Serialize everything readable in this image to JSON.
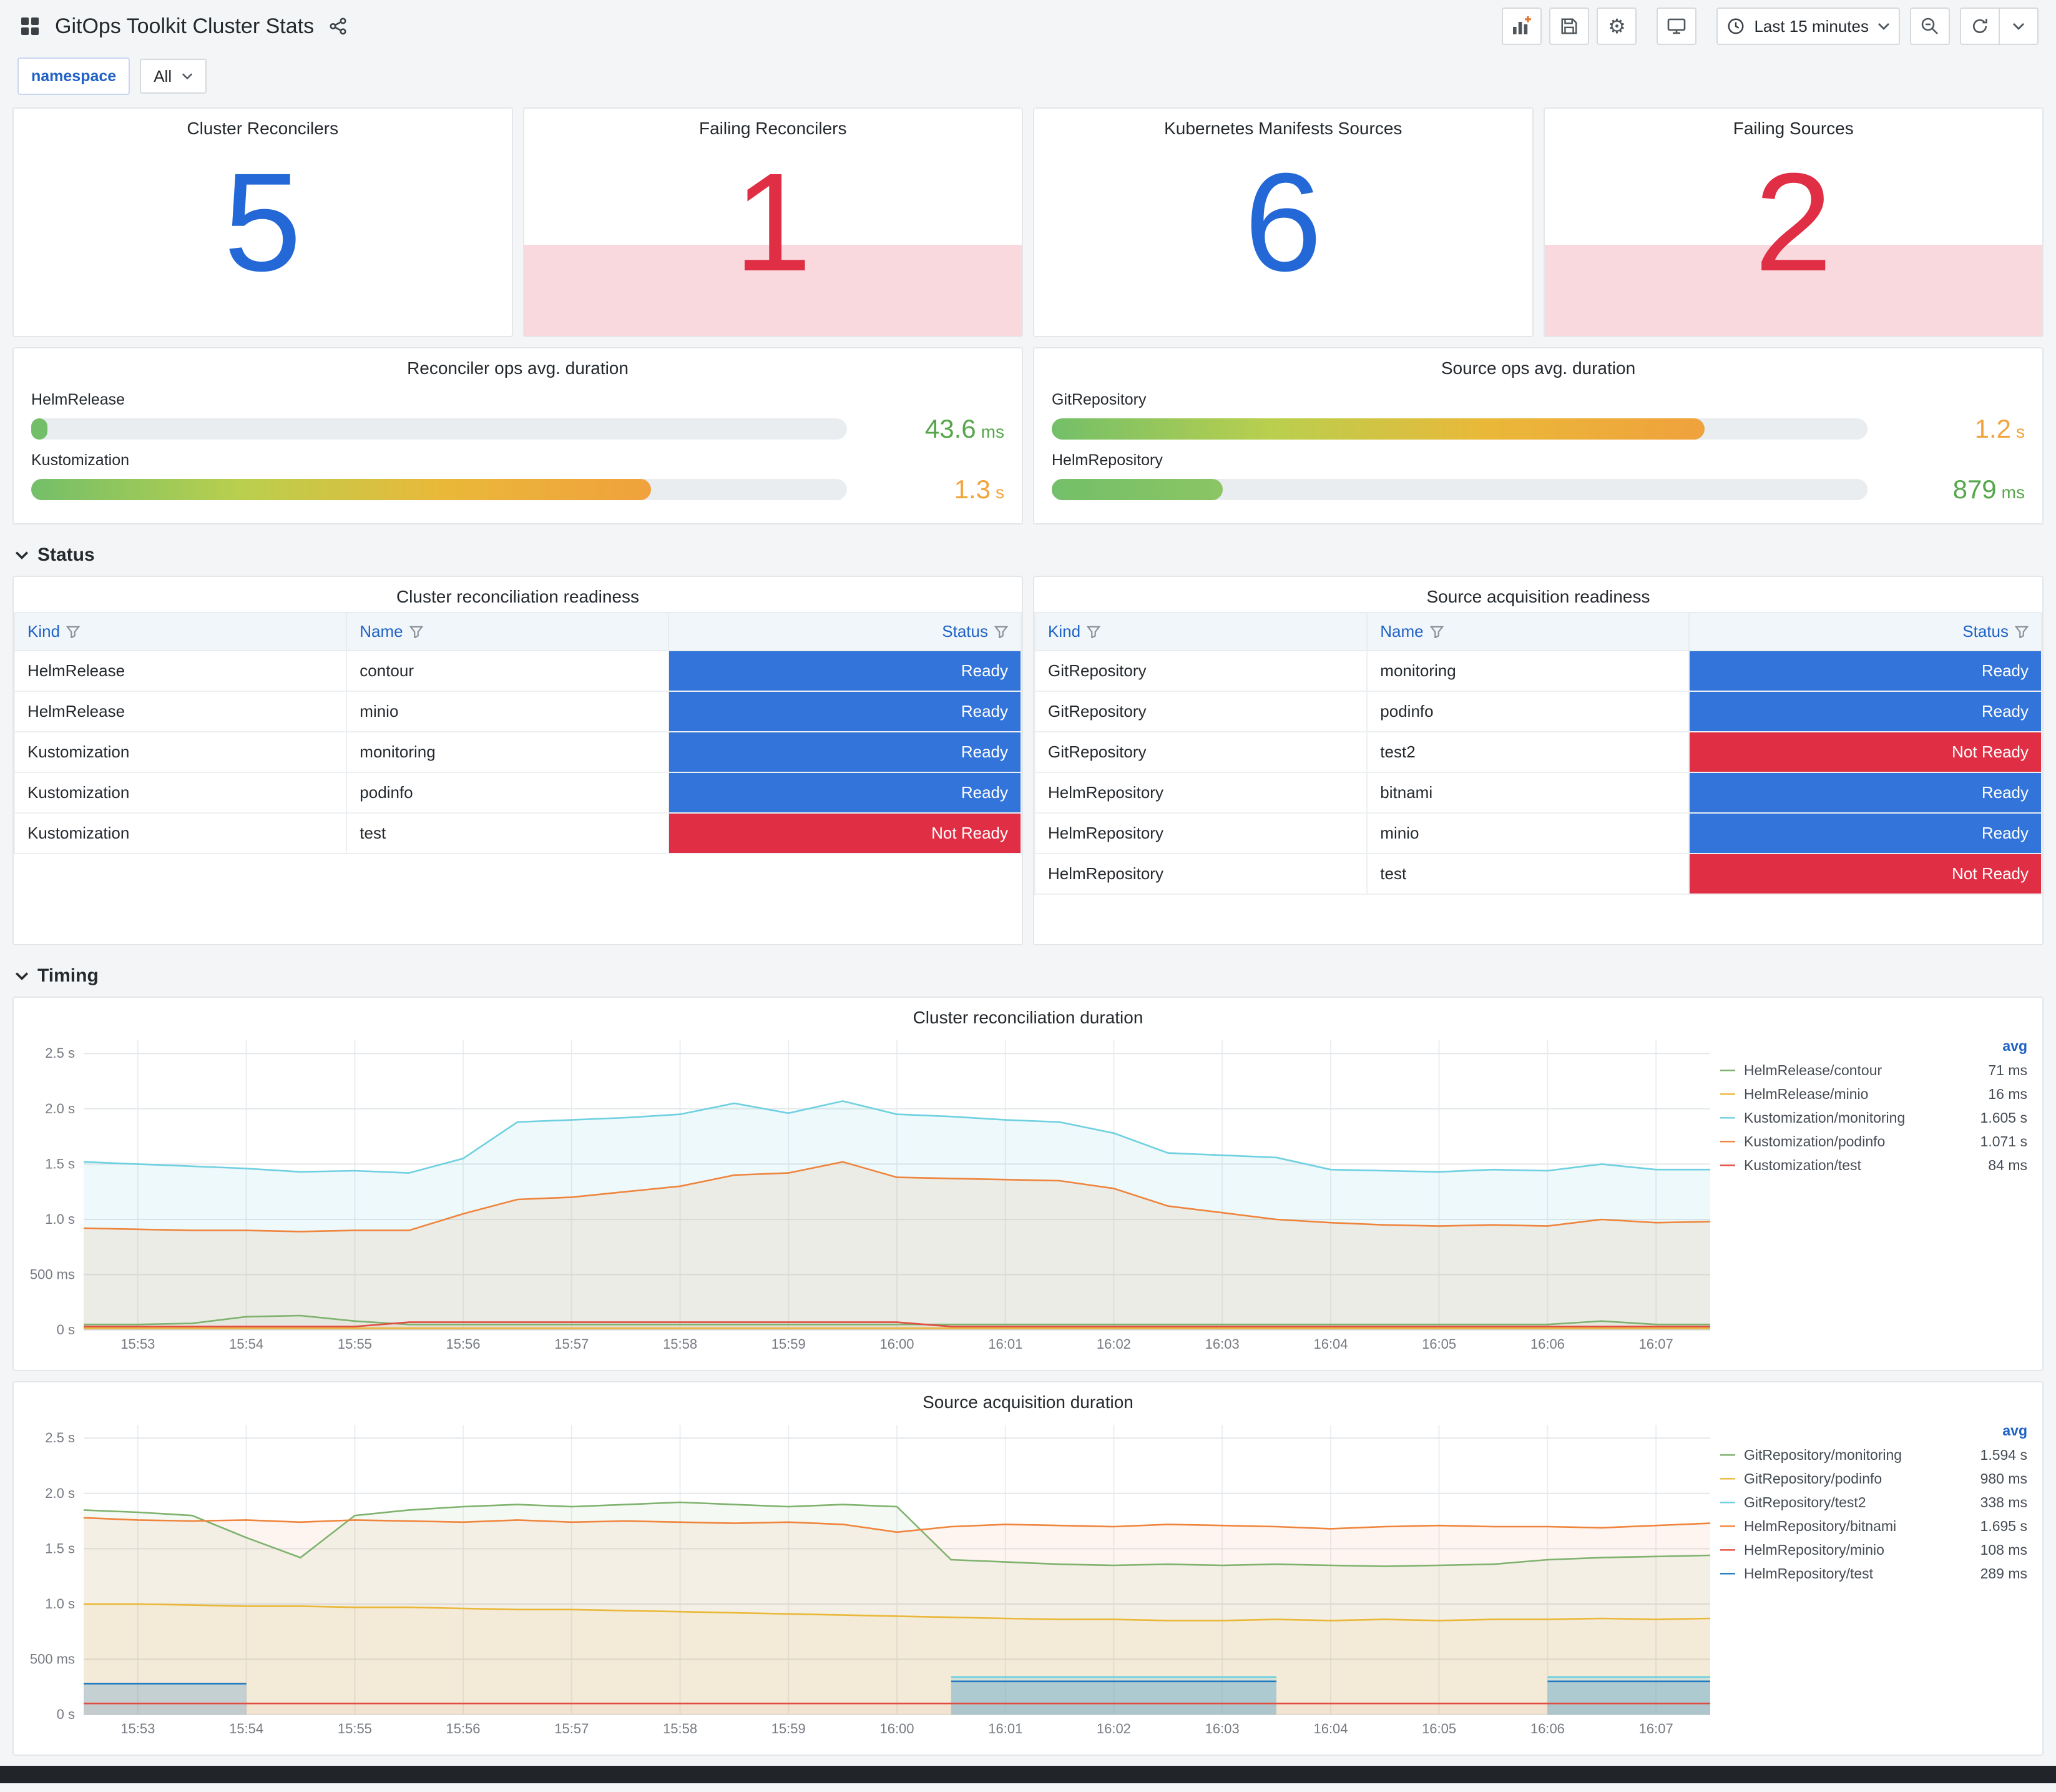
{
  "header": {
    "title": "GitOps Toolkit Cluster Stats",
    "time_range": "Last 15 minutes"
  },
  "variables": {
    "name": "namespace",
    "value": "All"
  },
  "colors": {
    "ready": "#3274d9",
    "not_ready": "#e02f44",
    "stat_blue": "#2368d6",
    "stat_red": "#e02f44",
    "link_blue": "#1f62c6"
  },
  "stat_panels": [
    {
      "title": "Cluster Reconcilers",
      "value": "5",
      "color": "#2368d6",
      "alert_band": false
    },
    {
      "title": "Failing Reconcilers",
      "value": "1",
      "color": "#e02f44",
      "alert_band": true
    },
    {
      "title": "Kubernetes Manifests Sources",
      "value": "6",
      "color": "#2368d6",
      "alert_band": false
    },
    {
      "title": "Failing Sources",
      "value": "2",
      "color": "#e02f44",
      "alert_band": true
    }
  ],
  "gauge_panels": [
    {
      "title": "Reconciler ops avg. duration",
      "rows": [
        {
          "label": "HelmRelease",
          "value": "43.6",
          "unit": "ms",
          "pct": 2,
          "value_color": "#56a64b",
          "bar_colors": [
            "#73bf69"
          ]
        },
        {
          "label": "Kustomization",
          "value": "1.3",
          "unit": "s",
          "pct": 76,
          "value_color": "#f2a33c",
          "bar_colors": [
            "#73bf69",
            "#b9cf4e",
            "#eab839",
            "#f0a13c"
          ]
        }
      ]
    },
    {
      "title": "Source ops avg. duration",
      "rows": [
        {
          "label": "GitRepository",
          "value": "1.2",
          "unit": "s",
          "pct": 80,
          "value_color": "#f2a33c",
          "bar_colors": [
            "#73bf69",
            "#b9cf4e",
            "#eab839",
            "#f0a13c"
          ]
        },
        {
          "label": "HelmRepository",
          "value": "879",
          "unit": "ms",
          "pct": 21,
          "value_color": "#56a64b",
          "bar_colors": [
            "#73bf69",
            "#8cc564"
          ]
        }
      ]
    }
  ],
  "sections": {
    "status": "Status",
    "timing": "Timing"
  },
  "tables": [
    {
      "title": "Cluster reconciliation readiness",
      "columns": [
        "Kind",
        "Name",
        "Status"
      ],
      "rows": [
        {
          "kind": "HelmRelease",
          "name": "contour",
          "status": "Ready"
        },
        {
          "kind": "HelmRelease",
          "name": "minio",
          "status": "Ready"
        },
        {
          "kind": "Kustomization",
          "name": "monitoring",
          "status": "Ready"
        },
        {
          "kind": "Kustomization",
          "name": "podinfo",
          "status": "Ready"
        },
        {
          "kind": "Kustomization",
          "name": "test",
          "status": "Not Ready"
        }
      ]
    },
    {
      "title": "Source acquisition readiness",
      "columns": [
        "Kind",
        "Name",
        "Status"
      ],
      "rows": [
        {
          "kind": "GitRepository",
          "name": "monitoring",
          "status": "Ready"
        },
        {
          "kind": "GitRepository",
          "name": "podinfo",
          "status": "Ready"
        },
        {
          "kind": "GitRepository",
          "name": "test2",
          "status": "Not Ready"
        },
        {
          "kind": "HelmRepository",
          "name": "bitnami",
          "status": "Ready"
        },
        {
          "kind": "HelmRepository",
          "name": "minio",
          "status": "Ready"
        },
        {
          "kind": "HelmRepository",
          "name": "test",
          "status": "Not Ready"
        }
      ]
    }
  ],
  "chart_data": [
    {
      "type": "line",
      "title": "Cluster reconciliation duration",
      "legend_header": "avg",
      "x_labels": [
        "15:53",
        "15:54",
        "15:55",
        "15:56",
        "15:57",
        "15:58",
        "15:59",
        "16:00",
        "16:01",
        "16:02",
        "16:03",
        "16:04",
        "16:05",
        "16:06",
        "16:07"
      ],
      "y_ticks": [
        {
          "v": 0,
          "label": "0 s"
        },
        {
          "v": 0.5,
          "label": "500 ms"
        },
        {
          "v": 1,
          "label": "1.0 s"
        },
        {
          "v": 1.5,
          "label": "1.5 s"
        },
        {
          "v": 2,
          "label": "2.0 s"
        },
        {
          "v": 2.5,
          "label": "2.5 s"
        }
      ],
      "ylim": [
        0,
        2.62
      ],
      "series": [
        {
          "name": "HelmRelease/contour",
          "color": "#7EB26D",
          "avg": "71 ms",
          "fill_opacity": 0.06,
          "values": [
            0.05,
            0.05,
            0.06,
            0.12,
            0.13,
            0.08,
            0.05,
            0.05,
            0.05,
            0.05,
            0.05,
            0.05,
            0.05,
            0.05,
            0.05,
            0.05,
            0.05,
            0.05,
            0.05,
            0.05,
            0.05,
            0.05,
            0.05,
            0.05,
            0.05,
            0.05,
            0.05,
            0.05,
            0.08,
            0.05,
            0.05
          ]
        },
        {
          "name": "HelmRelease/minio",
          "color": "#EAB839",
          "avg": "16 ms",
          "fill_opacity": 0.05,
          "values": [
            0.016,
            0.016,
            0.016,
            0.016,
            0.016,
            0.016,
            0.016,
            0.016,
            0.016,
            0.016,
            0.016,
            0.016,
            0.016,
            0.016,
            0.016,
            0.016,
            0.016,
            0.016,
            0.016,
            0.016,
            0.016,
            0.016,
            0.016,
            0.016,
            0.016,
            0.016,
            0.016,
            0.016,
            0.016,
            0.016,
            0.016
          ]
        },
        {
          "name": "Kustomization/monitoring",
          "color": "#6ED0E0",
          "avg": "1.605 s",
          "fill_opacity": 0.12,
          "values": [
            1.52,
            1.5,
            1.48,
            1.46,
            1.43,
            1.44,
            1.42,
            1.55,
            1.88,
            1.9,
            1.92,
            1.95,
            2.05,
            1.96,
            2.07,
            1.95,
            1.93,
            1.9,
            1.88,
            1.78,
            1.6,
            1.58,
            1.56,
            1.45,
            1.44,
            1.43,
            1.45,
            1.44,
            1.5,
            1.45,
            1.45
          ]
        },
        {
          "name": "Kustomization/podinfo",
          "color": "#EF843C",
          "avg": "1.071 s",
          "fill_opacity": 0.1,
          "values": [
            0.92,
            0.91,
            0.9,
            0.9,
            0.89,
            0.9,
            0.9,
            1.05,
            1.18,
            1.2,
            1.25,
            1.3,
            1.4,
            1.42,
            1.52,
            1.38,
            1.37,
            1.36,
            1.35,
            1.28,
            1.12,
            1.06,
            1.0,
            0.97,
            0.95,
            0.94,
            0.95,
            0.94,
            1.0,
            0.97,
            0.98
          ]
        },
        {
          "name": "Kustomization/test",
          "color": "#E24D42",
          "avg": "84 ms",
          "fill_opacity": 0.06,
          "values": [
            0.03,
            0.03,
            0.03,
            0.03,
            0.03,
            0.03,
            0.07,
            0.07,
            0.07,
            0.07,
            0.07,
            0.07,
            0.07,
            0.07,
            0.07,
            0.07,
            0.03,
            0.03,
            0.03,
            0.03,
            0.03,
            0.03,
            0.03,
            0.03,
            0.03,
            0.03,
            0.03,
            0.03,
            0.03,
            0.03,
            0.03
          ]
        }
      ]
    },
    {
      "type": "line",
      "title": "Source acquisition duration",
      "legend_header": "avg",
      "x_labels": [
        "15:53",
        "15:54",
        "15:55",
        "15:56",
        "15:57",
        "15:58",
        "15:59",
        "16:00",
        "16:01",
        "16:02",
        "16:03",
        "16:04",
        "16:05",
        "16:06",
        "16:07"
      ],
      "y_ticks": [
        {
          "v": 0,
          "label": "0 s"
        },
        {
          "v": 0.5,
          "label": "500 ms"
        },
        {
          "v": 1,
          "label": "1.0 s"
        },
        {
          "v": 1.5,
          "label": "1.5 s"
        },
        {
          "v": 2,
          "label": "2.0 s"
        },
        {
          "v": 2.5,
          "label": "2.5 s"
        }
      ],
      "ylim": [
        0,
        2.62
      ],
      "series": [
        {
          "name": "GitRepository/monitoring",
          "color": "#7EB26D",
          "avg": "1.594 s",
          "fill_opacity": 0.08,
          "values": [
            1.85,
            1.83,
            1.8,
            1.6,
            1.42,
            1.8,
            1.85,
            1.88,
            1.9,
            1.88,
            1.9,
            1.92,
            1.9,
            1.88,
            1.9,
            1.88,
            1.4,
            1.38,
            1.36,
            1.35,
            1.36,
            1.35,
            1.36,
            1.35,
            1.34,
            1.35,
            1.36,
            1.4,
            1.42,
            1.43,
            1.44
          ]
        },
        {
          "name": "GitRepository/podinfo",
          "color": "#EAB839",
          "avg": "980 ms",
          "fill_opacity": 0.08,
          "values": [
            1.0,
            1.0,
            0.99,
            0.98,
            0.98,
            0.97,
            0.97,
            0.96,
            0.95,
            0.95,
            0.94,
            0.93,
            0.92,
            0.91,
            0.9,
            0.89,
            0.88,
            0.87,
            0.86,
            0.86,
            0.85,
            0.85,
            0.86,
            0.85,
            0.86,
            0.85,
            0.86,
            0.86,
            0.87,
            0.86,
            0.87
          ]
        },
        {
          "name": "GitRepository/test2",
          "color": "#6ED0E0",
          "avg": "338 ms",
          "fill_opacity": 0.22,
          "values": [
            null,
            null,
            null,
            null,
            null,
            null,
            null,
            null,
            null,
            null,
            null,
            null,
            null,
            null,
            null,
            null,
            0.34,
            0.34,
            0.34,
            0.34,
            0.34,
            0.34,
            0.34,
            null,
            null,
            null,
            null,
            0.34,
            0.34,
            0.34,
            0.34
          ]
        },
        {
          "name": "HelmRepository/bitnami",
          "color": "#EF843C",
          "avg": "1.695 s",
          "fill_opacity": 0.08,
          "values": [
            1.78,
            1.76,
            1.75,
            1.76,
            1.74,
            1.76,
            1.75,
            1.74,
            1.76,
            1.74,
            1.75,
            1.74,
            1.73,
            1.74,
            1.72,
            1.65,
            1.7,
            1.72,
            1.71,
            1.7,
            1.72,
            1.71,
            1.7,
            1.68,
            1.7,
            1.71,
            1.7,
            1.7,
            1.69,
            1.71,
            1.73
          ]
        },
        {
          "name": "HelmRepository/minio",
          "color": "#E24D42",
          "avg": "108 ms",
          "fill_opacity": 0.04,
          "values": [
            0.1,
            0.1,
            0.1,
            0.1,
            0.1,
            0.1,
            0.1,
            0.1,
            0.1,
            0.1,
            0.1,
            0.1,
            0.1,
            0.1,
            0.1,
            0.1,
            0.1,
            0.1,
            0.1,
            0.1,
            0.1,
            0.1,
            0.1,
            0.1,
            0.1,
            0.1,
            0.1,
            0.1,
            0.1,
            0.1,
            0.1
          ]
        },
        {
          "name": "HelmRepository/test",
          "color": "#1F78C1",
          "avg": "289 ms",
          "fill_opacity": 0.22,
          "values": [
            0.28,
            0.28,
            0.28,
            0.28,
            null,
            null,
            null,
            null,
            null,
            null,
            null,
            null,
            null,
            null,
            null,
            null,
            0.3,
            0.3,
            0.3,
            0.3,
            0.3,
            0.3,
            0.3,
            null,
            null,
            null,
            null,
            0.3,
            0.3,
            0.3,
            0.3
          ]
        }
      ]
    }
  ]
}
